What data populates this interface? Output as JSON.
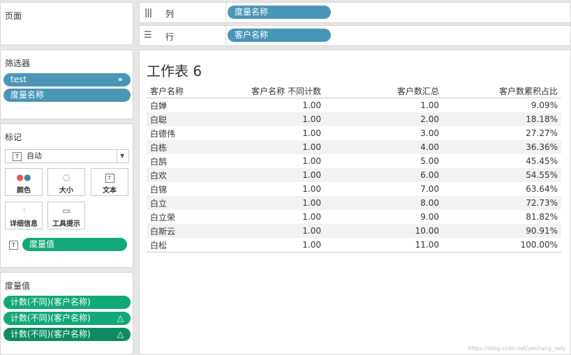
{
  "pages_panel": {
    "title": "页面"
  },
  "columns_shelf": {
    "label": "列",
    "pill": "度量名称"
  },
  "rows_shelf": {
    "label": "行",
    "pill": "客户名称"
  },
  "filters": {
    "title": "筛选器",
    "items": [
      "test",
      "度量名称"
    ]
  },
  "marks": {
    "title": "标记",
    "type_select": "自动",
    "buttons": [
      "颜色",
      "大小",
      "文本",
      "详细信息",
      "工具提示"
    ],
    "field_pill": "度量值"
  },
  "measure_values": {
    "title": "度量值",
    "items": [
      "计数(不同)(客户名称)",
      "计数(不同)(客户名称)",
      "计数(不同)(客户名称)"
    ]
  },
  "worksheet": {
    "title": "工作表 6",
    "headers": [
      "客户名称",
      "客户名称 不同计数",
      "客户数汇总",
      "客户数累积占比"
    ],
    "rows": [
      [
        "白婵",
        "1.00",
        "1.00",
        "9.09%"
      ],
      [
        "白聪",
        "1.00",
        "2.00",
        "18.18%"
      ],
      [
        "白德伟",
        "1.00",
        "3.00",
        "27.27%"
      ],
      [
        "白栋",
        "1.00",
        "4.00",
        "36.36%"
      ],
      [
        "白鹄",
        "1.00",
        "5.00",
        "45.45%"
      ],
      [
        "白欢",
        "1.00",
        "6.00",
        "54.55%"
      ],
      [
        "白锦",
        "1.00",
        "7.00",
        "63.64%"
      ],
      [
        "白立",
        "1.00",
        "8.00",
        "72.73%"
      ],
      [
        "白立荣",
        "1.00",
        "9.00",
        "81.82%"
      ],
      [
        "白斯云",
        "1.00",
        "10.00",
        "90.91%"
      ],
      [
        "白松",
        "1.00",
        "11.00",
        "100.00%"
      ]
    ]
  },
  "watermark": "https://blog.csdn.net/yeshang_lady",
  "colors": {
    "dimension_pill": "#4a96b6",
    "measure_pill": "#13a87a",
    "measure_pill_dark": "#0d8c64"
  }
}
